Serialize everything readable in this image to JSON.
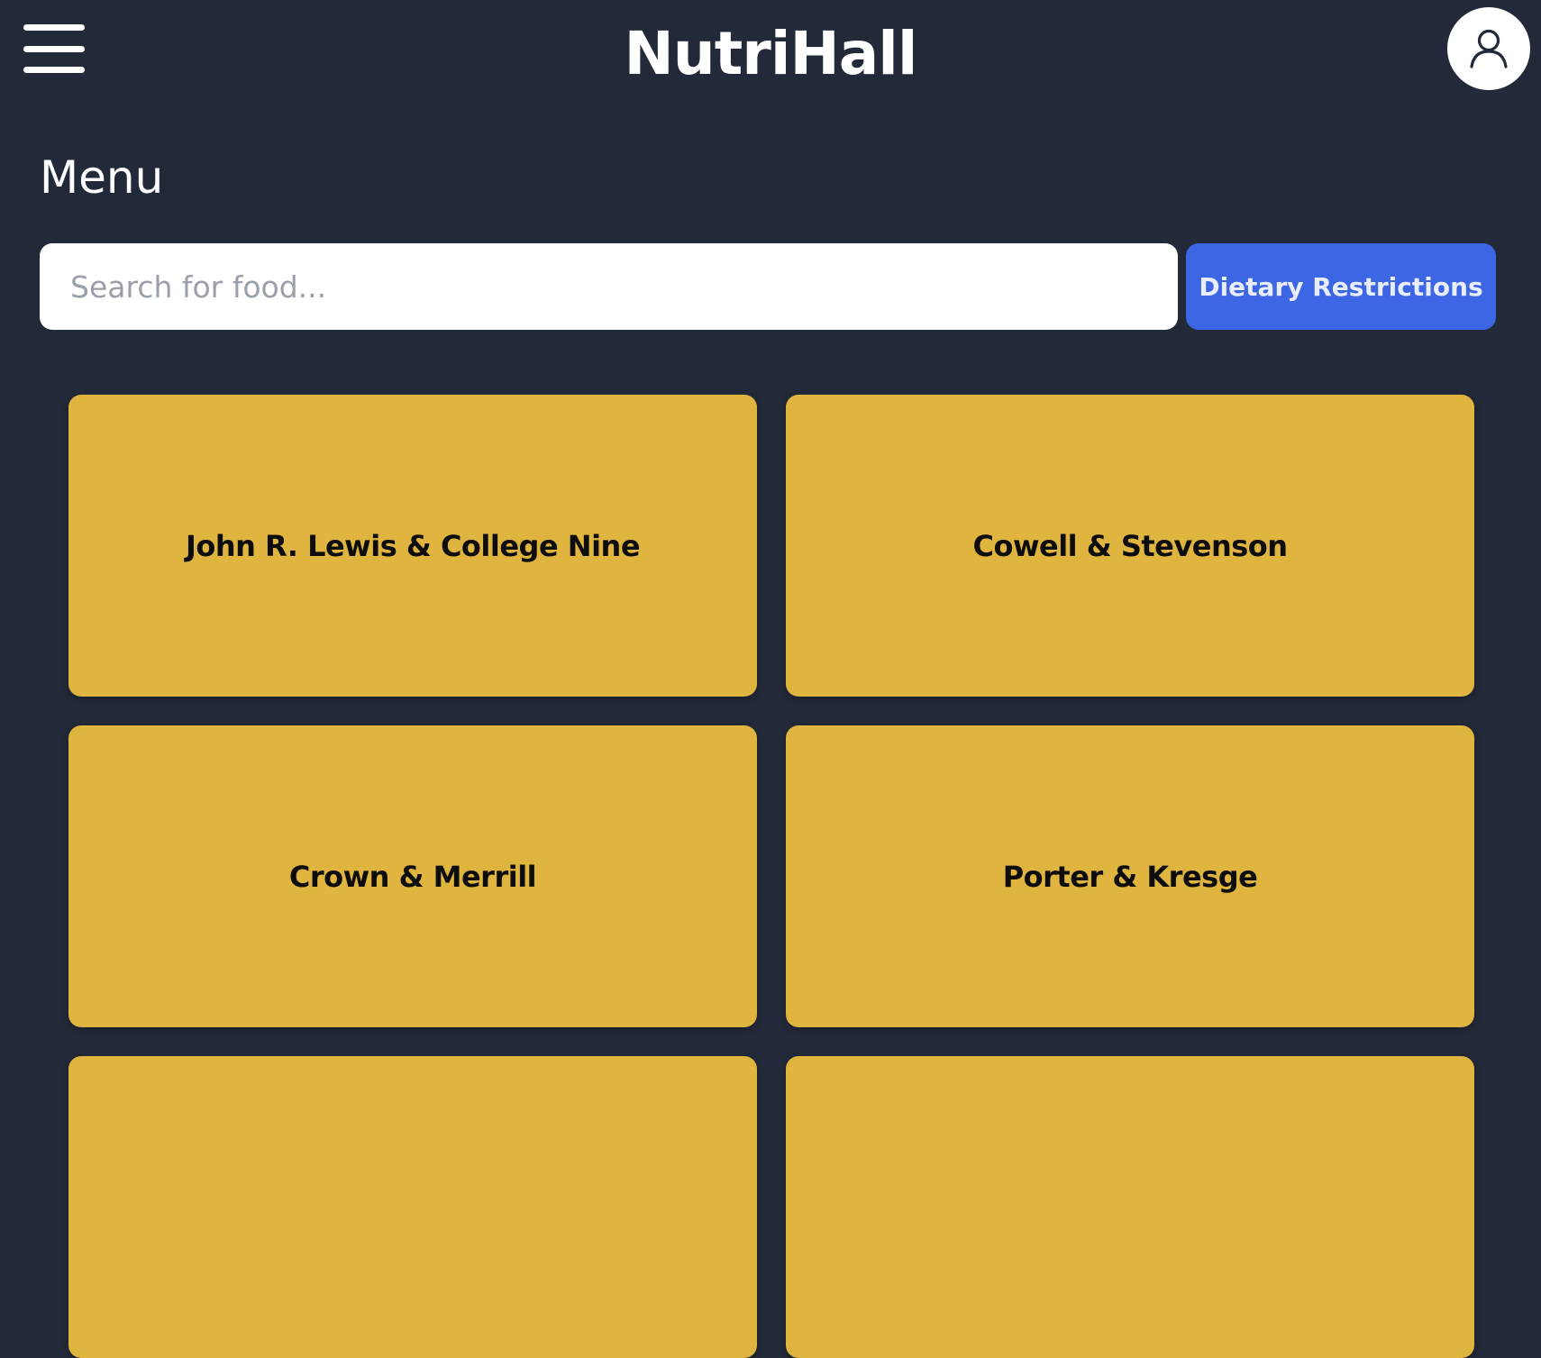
{
  "app": {
    "title": "NutriHall"
  },
  "page": {
    "title": "Menu"
  },
  "search": {
    "placeholder": "Search for food...",
    "value": ""
  },
  "filters": {
    "dietary_label": "Dietary Restrictions"
  },
  "icons": {
    "menu": "hamburger-menu-icon",
    "profile": "user-icon"
  },
  "colors": {
    "background": "#222938",
    "card": "#e0b53f",
    "accent": "#3d66e5"
  },
  "dining_halls": [
    {
      "name": "John R. Lewis & College Nine"
    },
    {
      "name": "Cowell & Stevenson"
    },
    {
      "name": "Crown & Merrill"
    },
    {
      "name": "Porter & Kresge"
    },
    {
      "name": ""
    },
    {
      "name": ""
    }
  ]
}
